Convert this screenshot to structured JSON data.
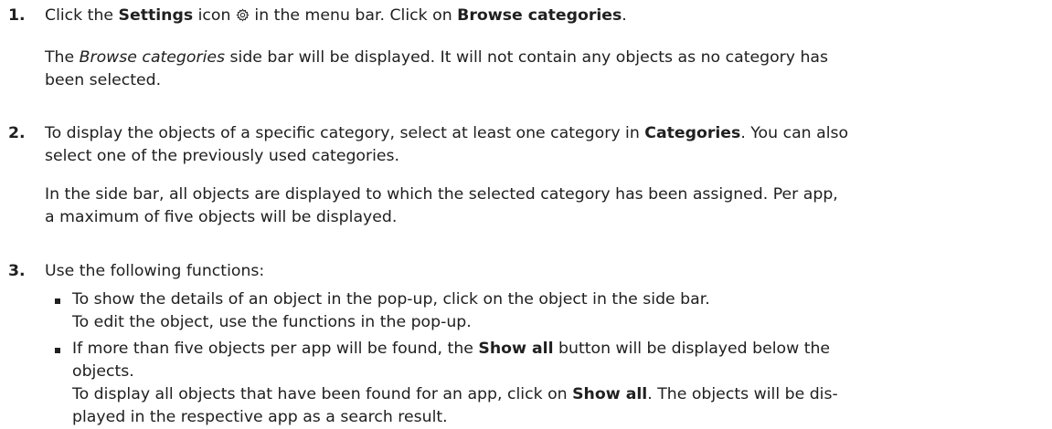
{
  "steps": [
    {
      "number": "1.",
      "line1_pre": "Click the ",
      "line1_bold1": "Settings",
      "line1_mid": " icon ",
      "line1_icon": "gear-icon",
      "line1_mid2": " in the menu bar. Click on ",
      "line1_bold2": "Browse categories",
      "line1_end": ".",
      "para_pre": "The ",
      "para_italic": "Browse categories",
      "para_line1_post": " side bar will be displayed. It will not contain any objects as no category has",
      "para_line2": "been selected."
    },
    {
      "number": "2.",
      "line1_pre": "To display the objects of a specific category, select at least one category in ",
      "line1_bold": "Categories",
      "line1_post": ". You can also",
      "line2": "select one of the previously used categories.",
      "para_line1": "In the side bar, all objects are displayed to which the selected category has been assigned. Per app,",
      "para_line2": "a maximum of five objects will be displayed."
    },
    {
      "number": "3.",
      "line1": "Use the following functions:",
      "bullets": [
        {
          "line1": "To show the details of an object in the pop-up, click on the object in the side bar.",
          "line2": "To edit the object, use the functions in the pop-up."
        },
        {
          "line1_pre": "If more than five objects per app will be found, the ",
          "line1_bold": "Show all",
          "line1_post": " button will be displayed below the",
          "line2": "objects.",
          "line3_pre": "To display all objects that have been found for an app, click on ",
          "line3_bold": "Show all",
          "line3_post": ". The objects will be dis-",
          "line4": "played in the respective app as a search result."
        }
      ]
    }
  ]
}
